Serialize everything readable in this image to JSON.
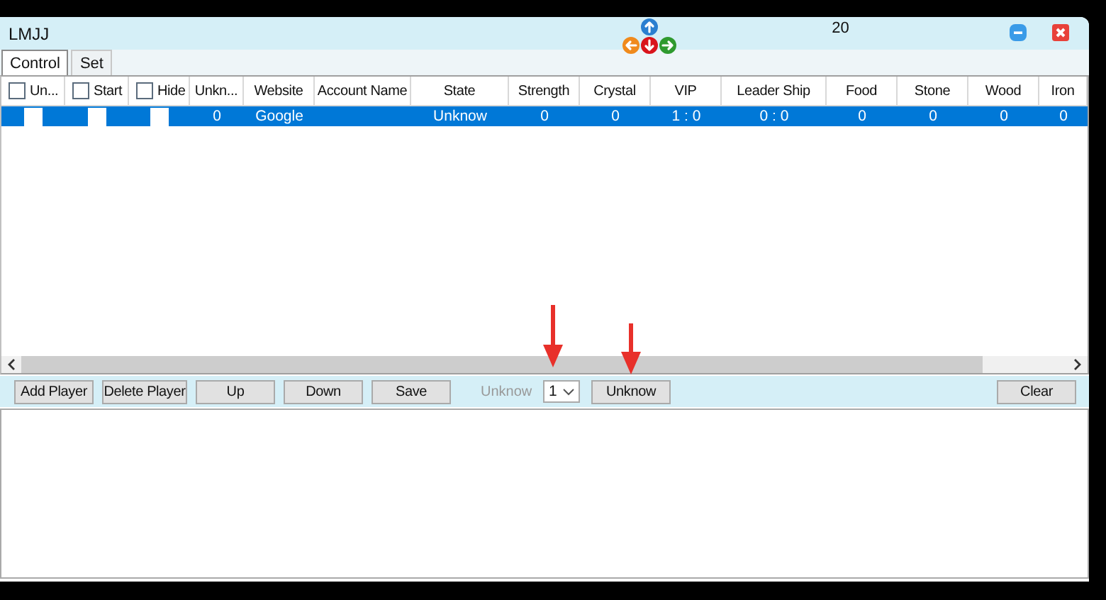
{
  "window": {
    "title": "LMJJ",
    "counter": "20"
  },
  "tabs": [
    {
      "label": "Control",
      "selected": true
    },
    {
      "label": "Set",
      "selected": false
    }
  ],
  "table": {
    "columns": [
      {
        "kind": "checkbox",
        "label": "Un...",
        "checked": false
      },
      {
        "kind": "checkbox",
        "label": "Start",
        "checked": false
      },
      {
        "kind": "checkbox",
        "label": "Hide",
        "checked": false
      },
      {
        "kind": "text",
        "label": "Unkn..."
      },
      {
        "kind": "text",
        "label": "Website"
      },
      {
        "kind": "text",
        "label": "Account Name"
      },
      {
        "kind": "text",
        "label": "State"
      },
      {
        "kind": "text",
        "label": "Strength"
      },
      {
        "kind": "text",
        "label": "Crystal"
      },
      {
        "kind": "text",
        "label": "VIP"
      },
      {
        "kind": "text",
        "label": "Leader Ship"
      },
      {
        "kind": "text",
        "label": "Food"
      },
      {
        "kind": "text",
        "label": "Stone"
      },
      {
        "kind": "text",
        "label": "Wood"
      },
      {
        "kind": "text",
        "label": "Iron"
      }
    ],
    "rows": [
      {
        "selected": true,
        "cells": [
          {
            "kind": "checkbox",
            "checked": false
          },
          {
            "kind": "checkbox",
            "checked": false
          },
          {
            "kind": "checkbox",
            "checked": false
          },
          {
            "kind": "text",
            "text": "0"
          },
          {
            "kind": "text",
            "text": "Google"
          },
          {
            "kind": "text",
            "text": ""
          },
          {
            "kind": "text",
            "text": "Unknow"
          },
          {
            "kind": "text",
            "text": "0"
          },
          {
            "kind": "text",
            "text": "0"
          },
          {
            "kind": "text",
            "text": "1 : 0"
          },
          {
            "kind": "text",
            "text": "0 : 0"
          },
          {
            "kind": "text",
            "text": "0"
          },
          {
            "kind": "text",
            "text": "0"
          },
          {
            "kind": "text",
            "text": "0"
          },
          {
            "kind": "text",
            "text": "0"
          }
        ]
      }
    ]
  },
  "toolbar": [
    {
      "kind": "button",
      "label": "Add Player"
    },
    {
      "kind": "button",
      "label": "Delete Player"
    },
    {
      "kind": "button",
      "label": "Up"
    },
    {
      "kind": "button",
      "label": "Down"
    },
    {
      "kind": "button",
      "label": "Save"
    },
    {
      "kind": "label",
      "label": "Unknow",
      "disabled": true
    },
    {
      "kind": "select",
      "value": "1"
    },
    {
      "kind": "button",
      "label": "Unknow"
    },
    {
      "kind": "button",
      "label": "Clear"
    }
  ]
}
